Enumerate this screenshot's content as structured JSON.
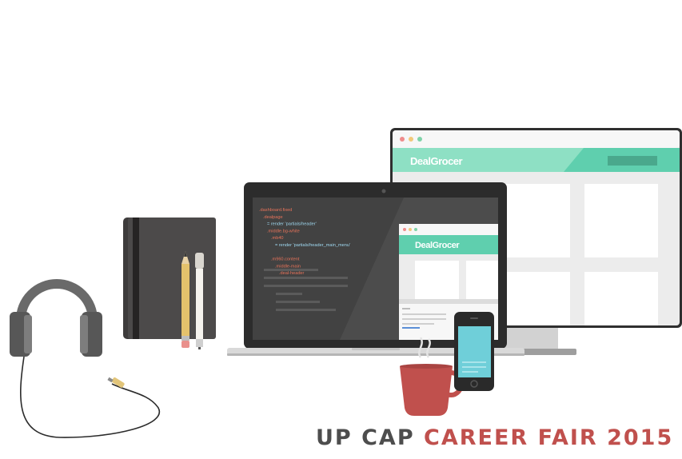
{
  "brand": {
    "name": "DealGrocer"
  },
  "code_lines": [
    {
      "text": ".dashboard.fixed",
      "color": "#e8735a",
      "indent": 0
    },
    {
      "text": ".dealpage",
      "color": "#e8735a",
      "indent": 1
    },
    {
      "text": "= render 'partials/header'",
      "color": "#9fd8f0",
      "indent": 2
    },
    {
      "text": ".middle.bg-white",
      "color": "#e8735a",
      "indent": 2
    },
    {
      "text": ".mb40",
      "color": "#e8735a",
      "indent": 3
    },
    {
      "text": "= render 'partials/header_main_menu'",
      "color": "#9fd8f0",
      "indent": 4
    },
    {
      "text": "",
      "color": "#e8735a",
      "indent": 0
    },
    {
      "text": ".m960.content",
      "color": "#e8735a",
      "indent": 3
    },
    {
      "text": ".middle-main",
      "color": "#e8735a",
      "indent": 4
    },
    {
      "text": ".deal-header",
      "color": "#e8735a",
      "indent": 5
    }
  ],
  "headline": {
    "part1": "UP CAP",
    "part2": "CAREER FAIR 2015"
  },
  "colors": {
    "accent": "#5fcfae",
    "accent_light": "#8ee0c4",
    "mug": "#c0504d",
    "phone_screen": "#6fcfd9",
    "headline_dark": "#4d4d4d",
    "headline_red": "#c0504d"
  },
  "icons": [
    "headphones-icon",
    "notebook-icon",
    "pencil-icon",
    "pen-icon",
    "laptop-icon",
    "monitor-icon",
    "coffee-mug-icon",
    "smartphone-icon"
  ]
}
